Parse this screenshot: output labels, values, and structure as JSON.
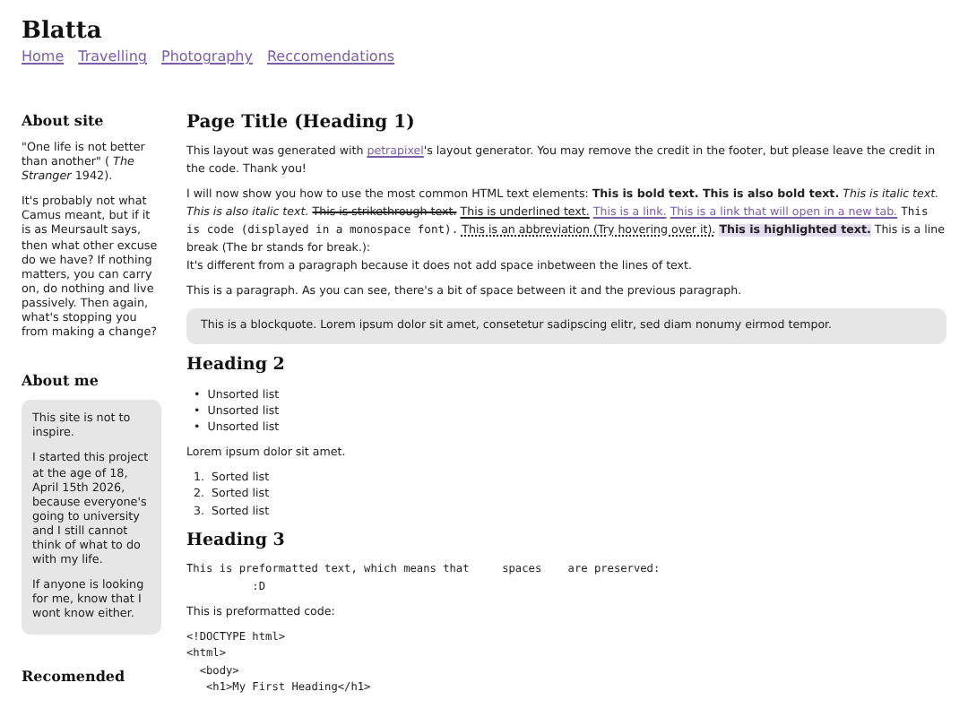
{
  "site_title": "Blatta",
  "nav": [
    "Home",
    "Travelling",
    "Photography",
    "Reccomendations"
  ],
  "sidebar": [
    {
      "heading": "About site",
      "kind": "plain",
      "paragraphs": [
        "\"One life is not better than another\" ( *The Stranger* 1942).",
        "It's probably not what Camus meant, but if it is as Meursault says, then what other excuse do we have? If nothing matters, you can carry on, do nothing and live passively. Then again, what's stopping you from making a change?"
      ]
    },
    {
      "heading": "About me",
      "kind": "boxed",
      "paragraphs": [
        "This site is not to inspire.",
        "I started this project at the age of 18, April 15th 2026, because everyone's going to university and I still cannot think of what to do with my life.",
        "If anyone is looking for me, know that I wont know either."
      ]
    },
    {
      "heading": "Recomended",
      "kind": "plain"
    }
  ],
  "main": {
    "title": "Page Title (Heading 1)",
    "paragraphs": [
      [
        {
          "kind": "text",
          "text": "This layout was generated with "
        },
        {
          "kind": "link",
          "text": "petrapixel"
        },
        {
          "kind": "text",
          "text": "'s layout generator. You may remove the credit in the footer, but please leave the credit in the code. Thank you!"
        }
      ],
      [
        {
          "kind": "text",
          "text": "I will now show you how to use the most common HTML text elements: "
        },
        {
          "kind": "bold",
          "text": "This is bold text. This is also bold text."
        },
        {
          "kind": "italic",
          "text": "This is italic text. This is also italic text."
        },
        {
          "kind": "strike",
          "text": "This is strikethrough text."
        },
        {
          "kind": "underline",
          "text": "This is underlined text."
        },
        {
          "kind": "link",
          "text": "This is a link."
        },
        {
          "kind": "link",
          "text": "This is a link that will open in a new tab."
        },
        {
          "kind": "code",
          "text": "This is code (displayed in a monospace font)."
        },
        {
          "kind": "abbr",
          "text": "This is an abbreviation (Try hovering over it)."
        },
        {
          "kind": "mark",
          "text": "This is highlighted text."
        },
        {
          "kind": "text",
          "text": " This is a line break (The br stands for break.):"
        },
        {
          "kind": "br"
        },
        {
          "kind": "text",
          "text": "It's different from a paragraph because it does not add space inbetween the lines of text."
        }
      ],
      [
        {
          "kind": "text",
          "text": "This is a paragraph. As you can see, there's a bit of space between it and the previous paragraph."
        }
      ]
    ],
    "blockquote": "This is a blockquote. Lorem ipsum dolor sit amet, consetetur sadipscing elitr, sed diam nonumy eirmod tempor.",
    "heading2": "Heading 2",
    "unordered": [
      {
        "marker": "•",
        "text": "Unsorted list"
      },
      {
        "marker": "•",
        "text": "Unsorted list"
      },
      {
        "marker": "•",
        "text": "Unsorted list"
      }
    ],
    "lorem": "Lorem ipsum dolor sit amet.",
    "ordered": [
      {
        "marker": "1.",
        "text": "Sorted list"
      },
      {
        "marker": "2.",
        "text": "Sorted list"
      },
      {
        "marker": "3.",
        "text": "Sorted list"
      }
    ],
    "heading3": "Heading 3",
    "pre_text": "This is preformatted text, which means that     spaces    are preserved:\n          :D",
    "code_label": "This is preformatted code:",
    "code": "<!DOCTYPE html>\n<html>\n  <body>\n   <h1>My First Heading</h1>"
  }
}
